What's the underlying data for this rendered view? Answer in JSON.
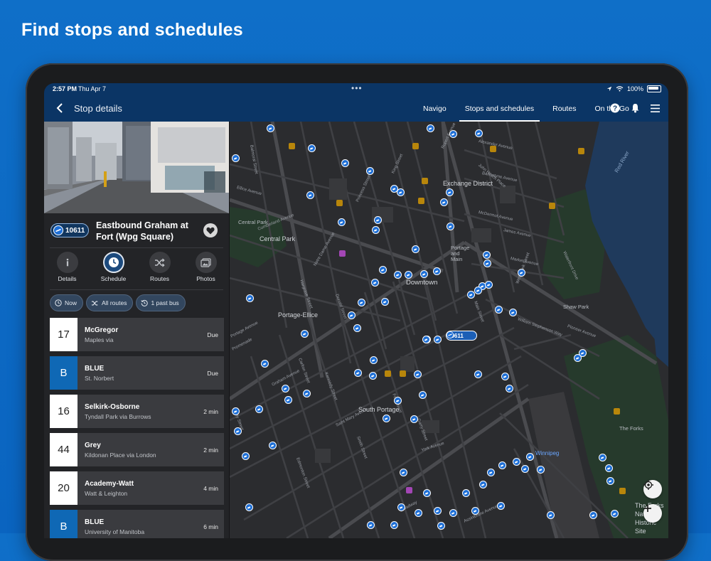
{
  "headline": "Find stops and schedules",
  "status_bar": {
    "time": "2:57 PM",
    "date": "Thu Apr 7",
    "battery": "100%"
  },
  "navbar": {
    "title": "Stop details",
    "tabs": [
      {
        "label": "Navigo"
      },
      {
        "label": "Stops and schedules"
      },
      {
        "label": "Routes"
      },
      {
        "label": "On the Go"
      }
    ]
  },
  "stop": {
    "number": "10611",
    "name": "Eastbound Graham at Fort (Wpg Square)"
  },
  "actions": [
    {
      "label": "Details"
    },
    {
      "label": "Schedule"
    },
    {
      "label": "Routes"
    },
    {
      "label": "Photos"
    }
  ],
  "filters": [
    {
      "label": "Now"
    },
    {
      "label": "All routes"
    },
    {
      "label": "1 past bus"
    }
  ],
  "routes": [
    {
      "number": "17",
      "name": "McGregor",
      "via": "Maples via",
      "time": "Due",
      "style": "white"
    },
    {
      "number": "B",
      "name": "BLUE",
      "via": "St. Norbert",
      "time": "Due",
      "style": "blue"
    },
    {
      "number": "16",
      "name": "Selkirk-Osborne",
      "via": "Tyndall Park via Burrows",
      "time": "2 min",
      "style": "white"
    },
    {
      "number": "44",
      "name": "Grey",
      "via": "Kildonan Place via London",
      "time": "2 min",
      "style": "white"
    },
    {
      "number": "20",
      "name": "Academy-Watt",
      "via": "Watt & Leighton",
      "time": "4 min",
      "style": "white"
    },
    {
      "number": "B",
      "name": "BLUE",
      "via": "University of Manitoba",
      "time": "6 min",
      "style": "blue"
    }
  ],
  "map": {
    "stop_badge": "10611",
    "labels": {
      "downtown": "Downtown",
      "exchange": "Exchange District",
      "central_park": "Central Park",
      "portage_ellice": "Portage-Ellice",
      "south_portage": "South Portage",
      "shaw_park": "Shaw Park",
      "the_forks": "The Forks",
      "winnipeg": "Winnipeg",
      "portage_main": "Portage and Main",
      "red_river": "Red River",
      "forks_site": "The Forks National Historic Site",
      "central_park_small": "Central Park"
    },
    "streets": {
      "cumberland": "Cumberland Avenue",
      "ellice": "Ellice Avenue",
      "portage": "Portage Avenue",
      "graham": "Graham Avenue",
      "st_mary": "Saint Mary Avenue",
      "york": "York Avenue",
      "broadway": "Broadway",
      "assiniboine": "Assiniboine Avenue",
      "main": "Main Street",
      "william_stephenson": "William Stephenson Way",
      "mcdermot": "McDermot Avenue",
      "bannatyne": "Bannatyne Avenue",
      "james": "James Avenue",
      "market": "Market Avenue",
      "notre_dame": "Notre Dame Avenue",
      "princess": "Princess Street",
      "king": "King Street",
      "hargrave": "Hargrave Street",
      "donald": "Donald Street",
      "carlton": "Carlton Street",
      "edmonton": "Edmonton Street",
      "kennedy": "Kennedy Street",
      "smith": "Smith Street",
      "garry": "Garry Street",
      "fort": "Fort Street",
      "waterfront": "Waterfront Drive",
      "westbrook": "Westbrook Street",
      "pioneer": "Pioneer Avenue",
      "balmoral": "Balmoral Street",
      "furby": "Furby Street",
      "promenade": "Promenade",
      "john_hirsch": "John Hirsch Place",
      "alexander": "Alexander Avenue",
      "rupert": "Rupert Avenue"
    }
  },
  "colors": {
    "nav": "#0b3565",
    "accent": "#1e6fd6",
    "background": "#0f6fc8"
  }
}
